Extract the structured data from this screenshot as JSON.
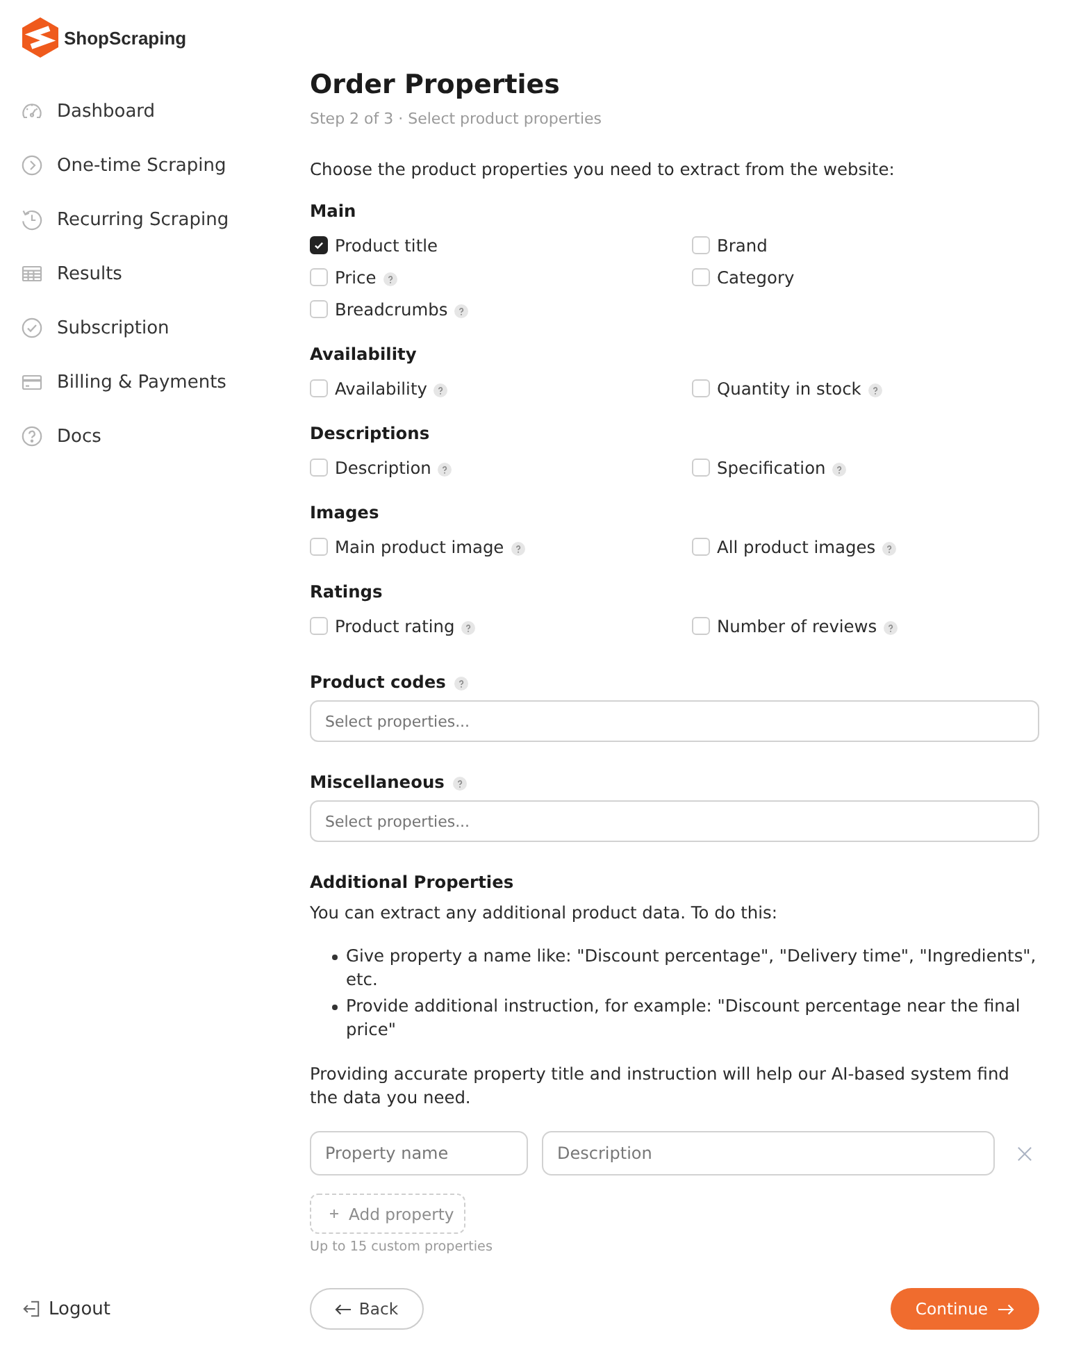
{
  "sidebar": {
    "logo": "ShopScraping",
    "items": [
      {
        "label": "Dashboard",
        "selected": false
      },
      {
        "label": "One-time Scraping",
        "selected": false
      },
      {
        "label": "Recurring Scraping",
        "selected": false
      },
      {
        "label": "Results",
        "selected": false
      },
      {
        "label": "Subscription",
        "selected": false
      },
      {
        "label": "Billing & Payments",
        "selected": false
      },
      {
        "label": "Docs",
        "selected": false
      }
    ],
    "logout": "Logout"
  },
  "page": {
    "title": "Order Properties",
    "subtitle": "Step 2 of 3 · Select product properties",
    "intro": "Choose the product properties you need to extract from the website:"
  },
  "sections": [
    {
      "kind": "checkboxes",
      "heading": "Main",
      "help": false,
      "options": [
        {
          "label": "Product title",
          "checked": true,
          "help": false
        },
        {
          "label": "Brand",
          "checked": false,
          "help": false
        },
        {
          "label": "Price",
          "checked": false,
          "help": true
        },
        {
          "label": "Category",
          "checked": false,
          "help": false
        },
        {
          "label": "Breadcrumbs",
          "checked": false,
          "help": true
        }
      ]
    },
    {
      "kind": "checkboxes",
      "heading": "Availability",
      "help": false,
      "options": [
        {
          "label": "Availability",
          "checked": false,
          "help": true
        },
        {
          "label": "Quantity in stock",
          "checked": false,
          "help": true
        }
      ]
    },
    {
      "kind": "checkboxes",
      "heading": "Descriptions",
      "help": false,
      "options": [
        {
          "label": "Description",
          "checked": false,
          "help": true
        },
        {
          "label": "Specification",
          "checked": false,
          "help": true
        }
      ]
    },
    {
      "kind": "checkboxes",
      "heading": "Images",
      "help": false,
      "options": [
        {
          "label": "Main product image",
          "checked": false,
          "help": true
        },
        {
          "label": "All product images",
          "checked": false,
          "help": true
        }
      ]
    },
    {
      "kind": "checkboxes",
      "heading": "Ratings",
      "help": false,
      "options": [
        {
          "label": "Product rating",
          "checked": false,
          "help": true
        },
        {
          "label": "Number of reviews",
          "checked": false,
          "help": true
        }
      ]
    },
    {
      "kind": "select",
      "heading": "Product codes",
      "help": true,
      "placeholder": "Select properties..."
    },
    {
      "kind": "select",
      "heading": "Miscellaneous",
      "help": true,
      "placeholder": "Select properties..."
    }
  ],
  "additional": {
    "heading": "Additional Properties",
    "intro": "You can extract any additional product data. To do this:",
    "bullets": [
      "Give property a name like: \"Discount percentage\", \"Delivery time\", \"Ingredients\", etc.",
      "Provide additional instruction, for example: \"Discount percentage near the final price\""
    ],
    "note": "Providing accurate property title and instruction will help our AI-based system find the data you need.",
    "rows": [
      {
        "name_placeholder": "Property name",
        "description_placeholder": "Description"
      }
    ],
    "add_label": "Add property",
    "hint": "Up to 15 custom properties"
  },
  "footer": {
    "back": "Back",
    "continue": "Continue"
  }
}
